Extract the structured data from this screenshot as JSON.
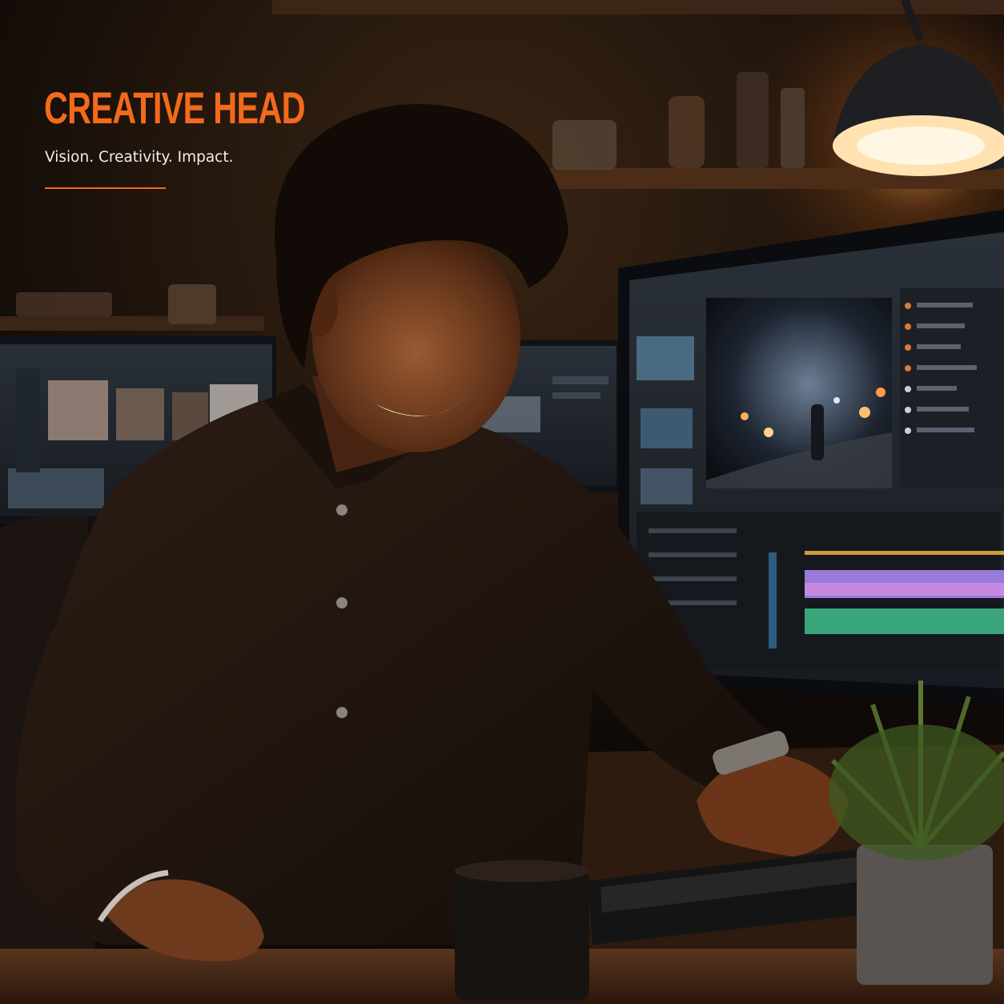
{
  "overlay": {
    "title": "CREATIVE HEAD",
    "tagline": "Vision. Creativity. Impact."
  },
  "colors": {
    "accent": "#f26a1b",
    "text": "#f3efe9",
    "background": "#120d09"
  },
  "photo": {
    "subject": "smiling young man in a dark shirt typing on a keyboard at a video-editing workstation",
    "icons": [
      "desk-lamp-icon",
      "monitor-icon",
      "keyboard-icon",
      "mug-icon",
      "plant-icon"
    ]
  }
}
